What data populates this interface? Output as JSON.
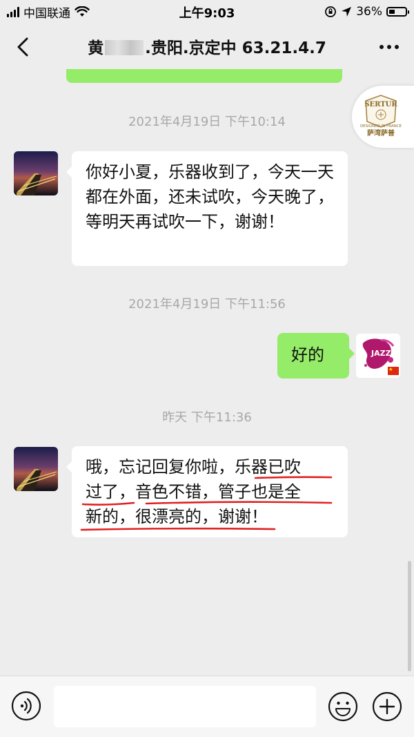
{
  "status_bar": {
    "carrier": "中国联通",
    "time": "上午9:03",
    "battery": "36%",
    "battery_level": 0.36
  },
  "nav": {
    "title_prefix": "黄",
    "title_suffix": ".贵阳.京定中 63.21.4.7"
  },
  "watermark": {
    "brand_top": "SERTUR",
    "brand_sub": "DESIGNED IN FRANCE",
    "brand_cn": "萨湾萨普"
  },
  "messages": [
    {
      "timestamp": "2021年4月19日 下午10:14",
      "text": "你好小夏，乐器收到了，今天一天都在外面，还未试吹，今天晚了，等明天再试吹一下，谢谢！"
    },
    {
      "timestamp": "2021年4月19日 下午11:56",
      "text": "好的"
    },
    {
      "timestamp": "昨天 下午11:36",
      "line1_plain": "哦，忘记回复你啦，",
      "line1_underlined": "乐器已吹",
      "line2_part1": "过了，",
      "line2_part2": "音色不错，管子也是全",
      "line3": "新的，很漂亮的，谢谢！"
    }
  ],
  "colors": {
    "own_bubble": "#95ec69",
    "other_bubble": "#ffffff",
    "background": "#ededed",
    "underline": "#e02020"
  },
  "icons": {
    "back": "chevron-left-icon",
    "more": "more-dots-icon",
    "voice": "voice-icon",
    "emoji": "emoji-icon",
    "add": "plus-icon"
  },
  "input": {
    "value": "",
    "placeholder": ""
  }
}
